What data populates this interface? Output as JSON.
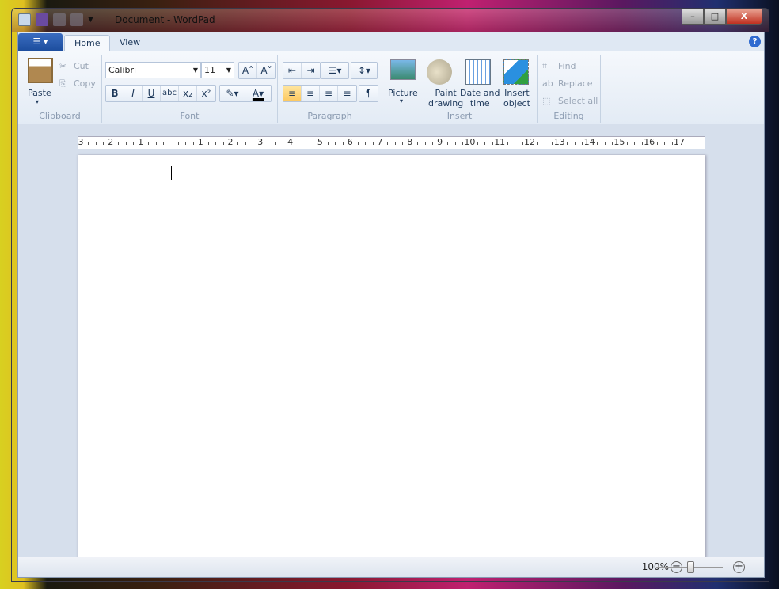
{
  "window": {
    "title": "Document - WordPad"
  },
  "tabs": [
    {
      "label": "Home",
      "active": true
    },
    {
      "label": "View",
      "active": false
    }
  ],
  "clipboard": {
    "paste": "Paste",
    "cut": "Cut",
    "copy": "Copy",
    "label": "Clipboard"
  },
  "font": {
    "family": "Calibri",
    "size": "11",
    "label": "Font",
    "buttons": [
      "B",
      "I",
      "U",
      "abc",
      "x₂",
      "x²"
    ],
    "color": "#000000"
  },
  "paragraph": {
    "label": "Paragraph",
    "alignment": "left"
  },
  "insert": {
    "label": "Insert",
    "picture": "Picture",
    "paint1": "Paint",
    "paint2": "drawing",
    "date1": "Date and",
    "date2": "time",
    "obj1": "Insert",
    "obj2": "object"
  },
  "editing": {
    "label": "Editing",
    "find": "Find",
    "replace": "Replace",
    "selectall": "Select all"
  },
  "ruler": {
    "labels": [
      "3",
      "2",
      "1",
      "",
      "1",
      "2",
      "3",
      "4",
      "5",
      "6",
      "7",
      "8",
      "9",
      "10",
      "11",
      "12",
      "13",
      "14",
      "15",
      "16",
      "17"
    ]
  },
  "status": {
    "zoom": "100%",
    "zoom_value": 100
  }
}
